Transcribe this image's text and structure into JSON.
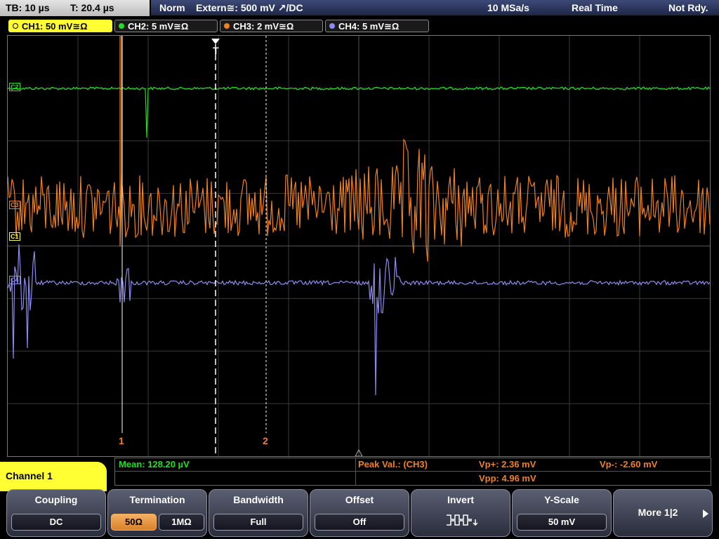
{
  "status_bar": {
    "timebase": "TB: 10 µs",
    "trigger_time": "T: 20.4 µs",
    "trigger_mode": "Norm",
    "trigger_source": "Extern≅: 500 mV ↗/DC",
    "sample_rate": "10 MSa/s",
    "acq_mode": "Real Time",
    "state": "Not Rdy."
  },
  "channels": [
    {
      "label": "CH1: 50 mV≅Ω",
      "color": "#ffff33"
    },
    {
      "label": "CH2: 5 mV≅Ω",
      "color": "#22dd22"
    },
    {
      "label": "CH3: 2 mV≅Ω",
      "color": "#f08020"
    },
    {
      "label": "CH4: 5 mV≅Ω",
      "color": "#8c8cf0"
    }
  ],
  "markers": {
    "trigger": "T",
    "cursor1": "1",
    "cursor2": "2",
    "ch2_tag": "C2",
    "ch3_tag": "C3",
    "ch1_tag": "C1",
    "ch4_tag": "C4"
  },
  "measurements": {
    "mean": "Mean: 128.20 µV",
    "peak_label": "Peak Val.: (CH3)",
    "vp_plus": "Vp+: 2.36 mV",
    "vpp": "Vpp: 4.96 mV",
    "vp_minus": "Vp-: -2.60 mV"
  },
  "menu": {
    "channel_title": "Channel 1",
    "softkeys": [
      {
        "title": "Coupling",
        "value": "DC"
      },
      {
        "title": "Termination",
        "options": [
          "50Ω",
          "1MΩ"
        ],
        "selected": "50Ω"
      },
      {
        "title": "Bandwidth",
        "value": "Full"
      },
      {
        "title": "Offset",
        "value": "Off"
      },
      {
        "title": "Invert",
        "icon": "invert-waveform-icon"
      },
      {
        "title": "Y-Scale",
        "value": "50 mV"
      },
      {
        "title": "More 1|2",
        "icon": "arrow-right-icon"
      }
    ]
  },
  "colors": {
    "grid": "#3a3a3a",
    "ch2": "#22dd22",
    "ch3": "#f08020",
    "ch4": "#8c8cf0",
    "accent": "#ffff33"
  }
}
